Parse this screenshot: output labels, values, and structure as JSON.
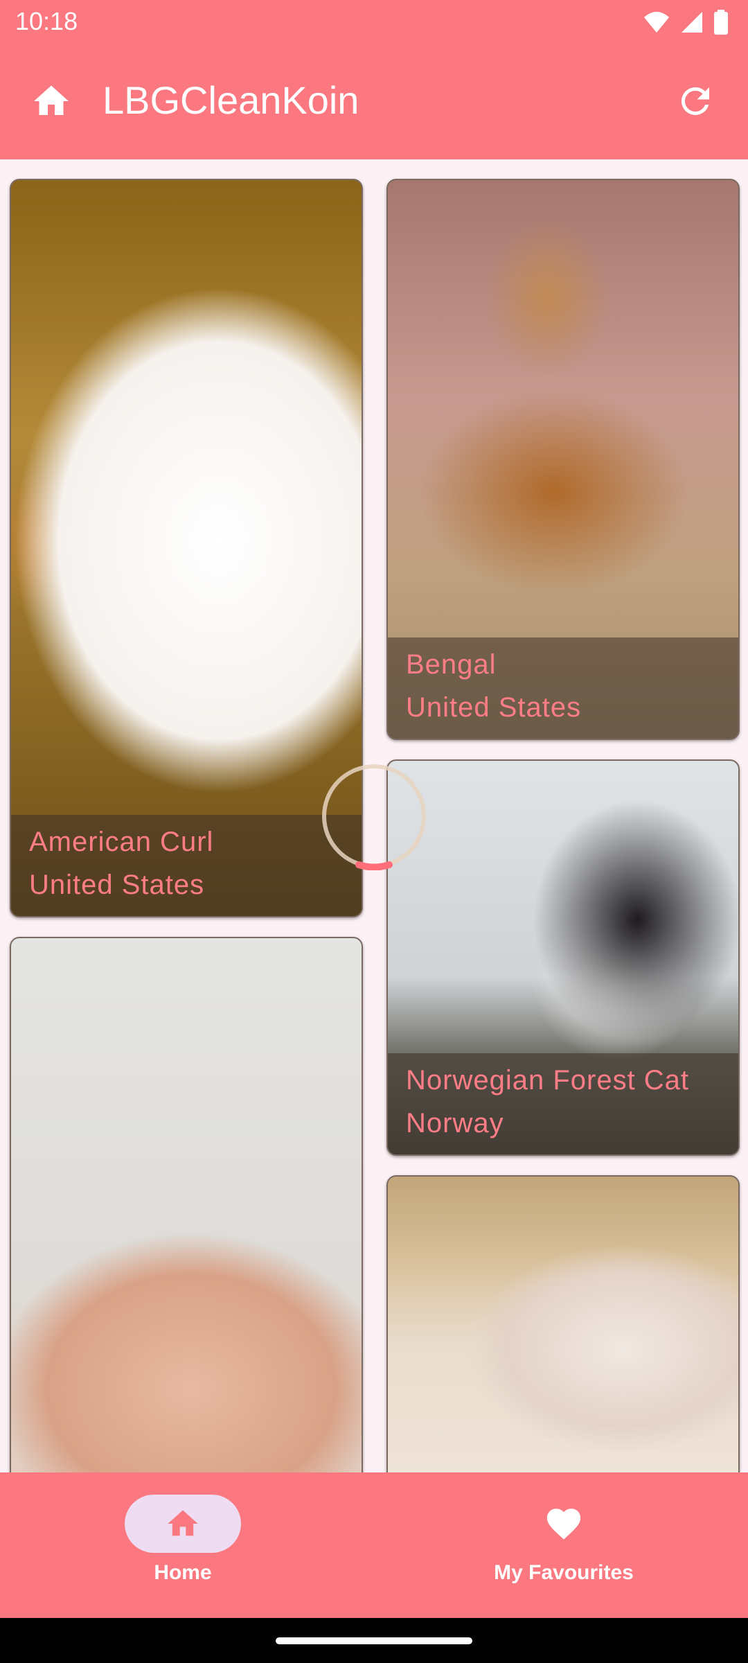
{
  "status_bar": {
    "time": "10:18",
    "icons": [
      "wifi-icon",
      "cellular-signal-icon",
      "battery-icon"
    ]
  },
  "app_bar": {
    "title": "LBGCleanKoin",
    "home_icon": "home-icon",
    "refresh_icon": "refresh-icon",
    "color": "#fc7880"
  },
  "breeds": [
    {
      "name": "American Curl",
      "origin": "United States"
    },
    {
      "name": "Bengal",
      "origin": "United States"
    },
    {
      "name": "Norwegian Forest Cat",
      "origin": "Norway"
    },
    {
      "name": "",
      "origin": ""
    },
    {
      "name": "",
      "origin": ""
    }
  ],
  "colors": {
    "accent": "#fc7880",
    "label_text": "#ff7d86",
    "nav_indicator": "#eedcf2"
  },
  "bottom_nav": {
    "items": [
      {
        "label": "Home",
        "icon": "home-icon",
        "selected": true
      },
      {
        "label": "My Favourites",
        "icon": "heart-icon",
        "selected": false
      }
    ]
  }
}
